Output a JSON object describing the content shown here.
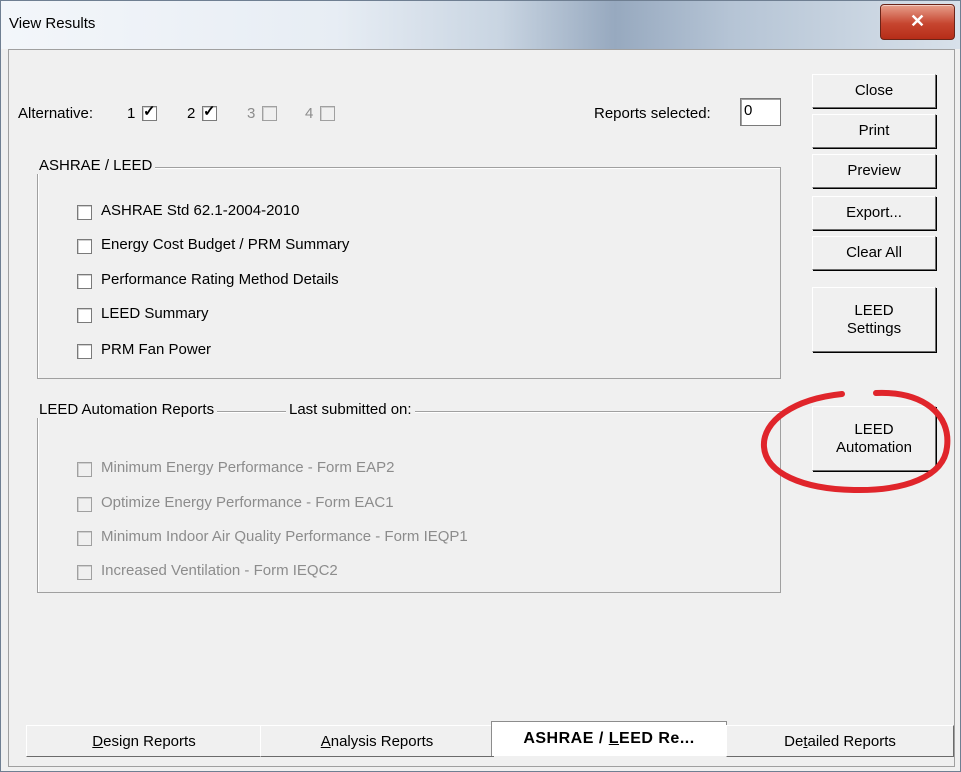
{
  "window": {
    "title": "View Results",
    "close_glyph": "✕"
  },
  "alternative": {
    "label": "Alternative:",
    "items": [
      {
        "label": "1",
        "checked": true,
        "enabled": true
      },
      {
        "label": "2",
        "checked": true,
        "enabled": true
      },
      {
        "label": "3",
        "checked": false,
        "enabled": false
      },
      {
        "label": "4",
        "checked": false,
        "enabled": false
      }
    ]
  },
  "reports_selected": {
    "label": "Reports selected:",
    "value": "0"
  },
  "ashrae_group": {
    "title": "ASHRAE / LEED",
    "items": [
      "ASHRAE Std 62.1-2004-2010",
      "Energy Cost Budget / PRM Summary",
      "Performance Rating Method Details",
      "LEED Summary",
      "PRM Fan Power"
    ]
  },
  "automation_group": {
    "title": "LEED Automation Reports",
    "last_submitted_label": "Last submitted on:",
    "items": [
      "Minimum Energy Performance - Form EAP2",
      "Optimize Energy Performance - Form EAC1",
      "Minimum Indoor Air Quality Performance - Form IEQP1",
      "Increased Ventilation - Form IEQC2"
    ]
  },
  "buttons": {
    "close": "Close",
    "print": "Print",
    "preview": "Preview",
    "export": "Export...",
    "clear_all": "Clear All",
    "leed_settings_1": "LEED",
    "leed_settings_2": "Settings",
    "leed_automation_1": "LEED",
    "leed_automation_2": "Automation"
  },
  "tabs": [
    {
      "pre": "",
      "key": "D",
      "post": "esign Reports",
      "active": false
    },
    {
      "pre": "",
      "key": "A",
      "post": "nalysis Reports",
      "active": false
    },
    {
      "pre": "ASHRAE / ",
      "key": "L",
      "post": "EED Re...",
      "active": true
    },
    {
      "pre": "De",
      "key": "t",
      "post": "ailed Reports",
      "active": false
    }
  ],
  "colors": {
    "highlight_circle": "#e0252b"
  }
}
